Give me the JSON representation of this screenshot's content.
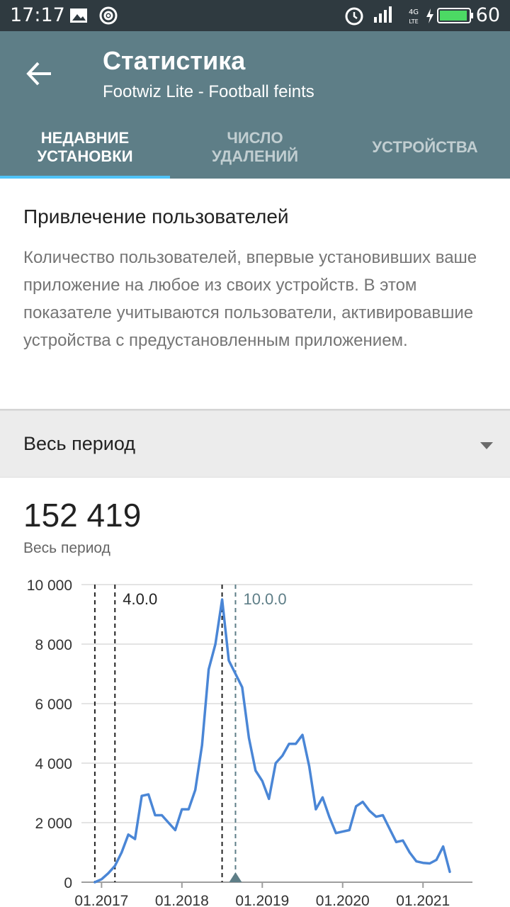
{
  "status_bar": {
    "time": "17:17",
    "battery_percent": "60",
    "network_label": "4G LTE",
    "battery_color": "#4cd964"
  },
  "header": {
    "title": "Статистика",
    "subtitle": "Footwiz Lite - Football feints",
    "back_icon": "arrow-left-icon",
    "background": "#5e7e87"
  },
  "tabs": [
    {
      "label": "Недавние установки",
      "active": true
    },
    {
      "label": "Число удалений",
      "active": false
    },
    {
      "label": "Устройства",
      "active": false
    }
  ],
  "info_card": {
    "title": "Привлечение пользователей",
    "description": "Количество пользователей, впервые установивших ваше приложение на любое из своих устройств. В этом показателе учитываются пользователи, активировавшие устройства с предустановленным приложением."
  },
  "period_selector": {
    "label": "Весь период",
    "icon": "dropdown-arrow-icon"
  },
  "stats": {
    "total": "152 419",
    "caption": "Весь период"
  },
  "chart_data": {
    "type": "line",
    "x_tick_labels": [
      "01.2017",
      "01.2018",
      "01.2019",
      "01.2020",
      "01.2021"
    ],
    "y_tick_labels": [
      "0",
      "2 000",
      "4 000",
      "6 000",
      "8 000",
      "10 000"
    ],
    "ylim": [
      0,
      10000
    ],
    "grid": true,
    "series": [
      {
        "color": "#4a86d6",
        "x": [
          "2016-12",
          "2017-01",
          "2017-02",
          "2017-03",
          "2017-04",
          "2017-05",
          "2017-06",
          "2017-07",
          "2017-08",
          "2017-09",
          "2017-10",
          "2017-11",
          "2017-12",
          "2018-01",
          "2018-02",
          "2018-03",
          "2018-04",
          "2018-05",
          "2018-06",
          "2018-07",
          "2018-08",
          "2018-09",
          "2018-10",
          "2018-11",
          "2018-12",
          "2019-01",
          "2019-02",
          "2019-03",
          "2019-04",
          "2019-05",
          "2019-06",
          "2019-07",
          "2019-08",
          "2019-09",
          "2019-10",
          "2019-11",
          "2019-12",
          "2020-01",
          "2020-02",
          "2020-03",
          "2020-04",
          "2020-05",
          "2020-06",
          "2020-07",
          "2020-08",
          "2020-09",
          "2020-10",
          "2020-11",
          "2020-12",
          "2021-01",
          "2021-02",
          "2021-03",
          "2021-04",
          "2021-05"
        ],
        "values": [
          0,
          100,
          300,
          550,
          1000,
          1600,
          1450,
          2900,
          2950,
          2250,
          2250,
          2000,
          1750,
          2450,
          2450,
          3100,
          4600,
          7150,
          8000,
          9500,
          7450,
          7000,
          6550,
          4850,
          3750,
          3400,
          2800,
          4000,
          4250,
          4650,
          4650,
          4950,
          3900,
          2450,
          2850,
          2200,
          1650,
          1700,
          1750,
          2550,
          2700,
          2400,
          2200,
          2250,
          1800,
          1350,
          1400,
          1000,
          700,
          650,
          630,
          750,
          1200,
          350
        ]
      }
    ],
    "annotations": [
      {
        "label": "",
        "x": "2016-12",
        "color": "#222222"
      },
      {
        "label": "4.0.0",
        "x": "2017-03",
        "color": "#222222"
      },
      {
        "label": "",
        "x": "2018-07",
        "color": "#222222"
      },
      {
        "label": "10.0.0",
        "x": "2018-09",
        "color": "#5e7e87",
        "marker": true
      }
    ]
  }
}
